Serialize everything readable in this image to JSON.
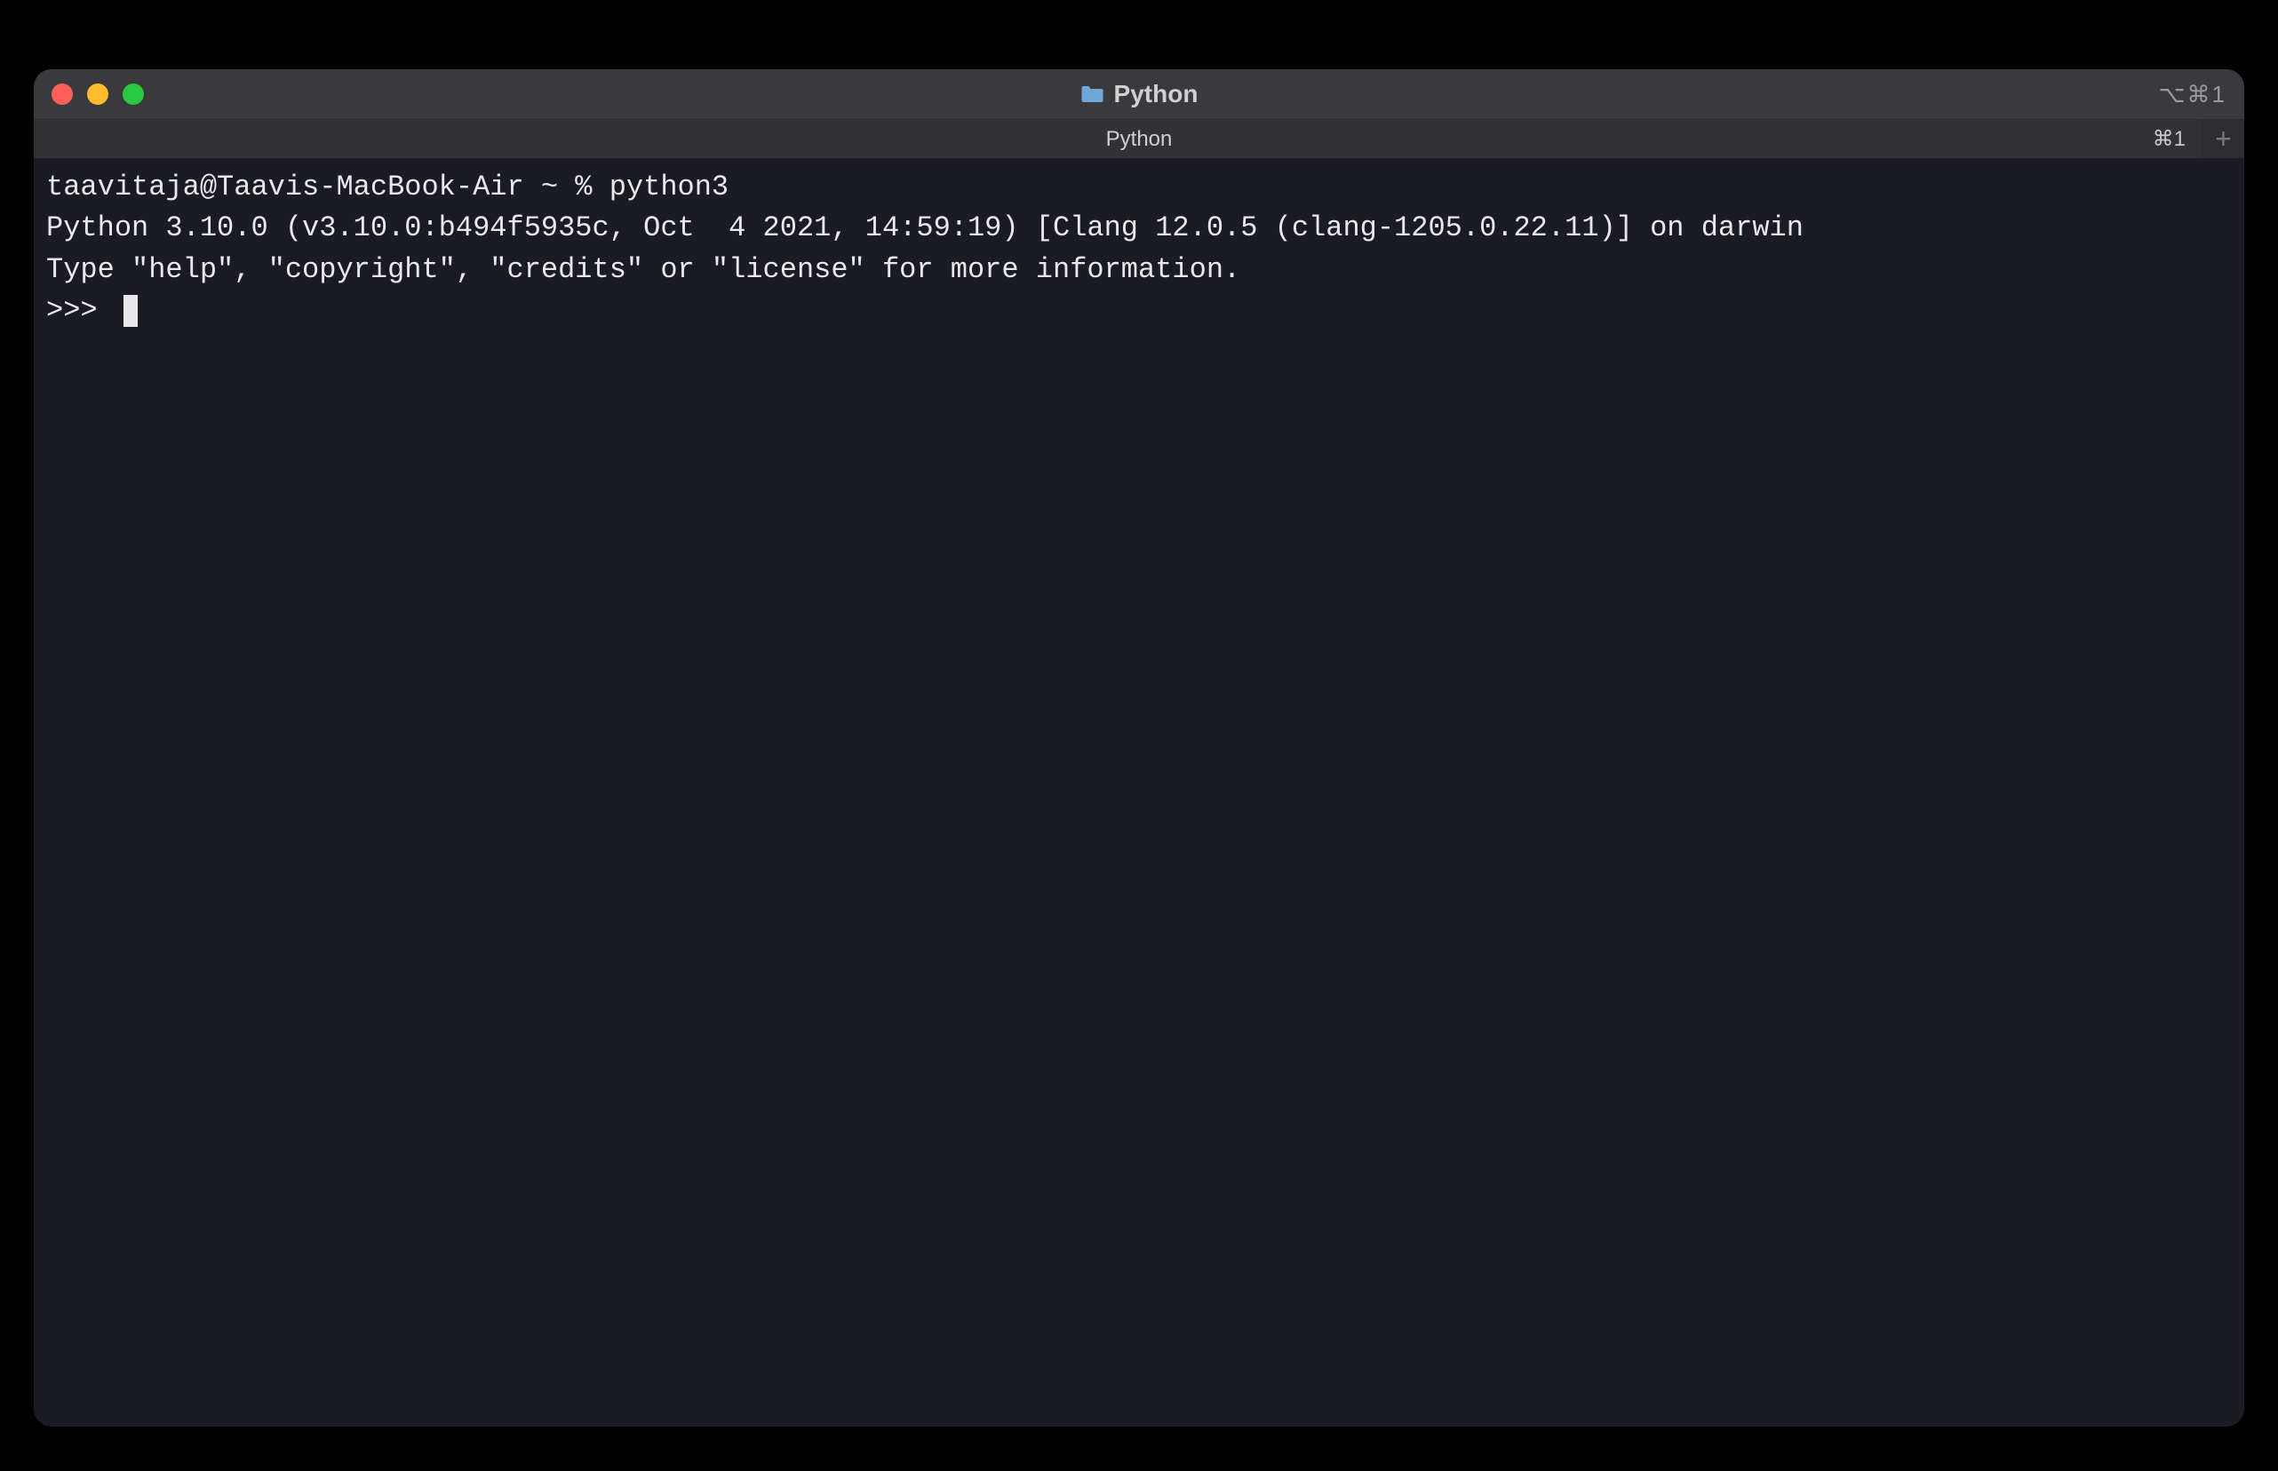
{
  "window": {
    "title": "Python",
    "title_shortcut": "⌥⌘1"
  },
  "tabs": {
    "active_label": "Python",
    "active_shortcut": "⌘1",
    "add_label": "+"
  },
  "terminal": {
    "lines": [
      "taavitaja@Taavis-MacBook-Air ~ % python3",
      "Python 3.10.0 (v3.10.0:b494f5935c, Oct  4 2021, 14:59:19) [Clang 12.0.5 (clang-1205.0.22.11)] on darwin",
      "Type \"help\", \"copyright\", \"credits\" or \"license\" for more information."
    ],
    "prompt": ">>> "
  }
}
